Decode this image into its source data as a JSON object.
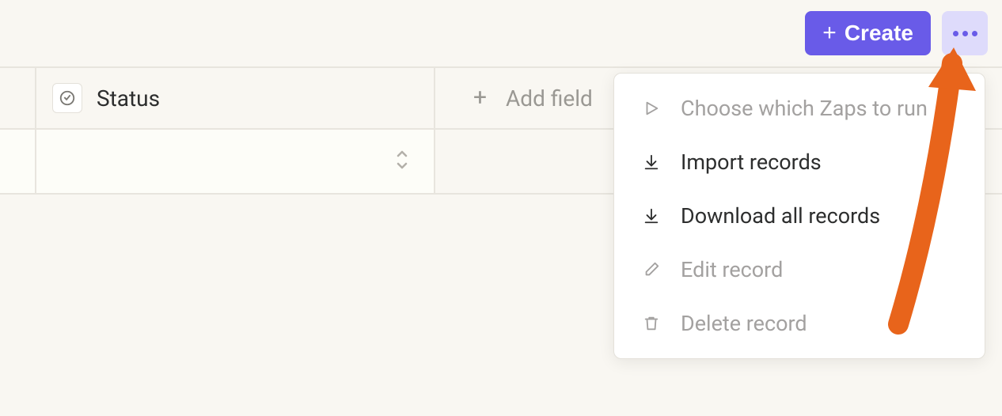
{
  "toolbar": {
    "create_label": "Create"
  },
  "columns": {
    "status_label": "Status",
    "add_field_label": "Add field"
  },
  "menu": {
    "items": [
      {
        "label": "Choose which Zaps to run",
        "icon": "play",
        "disabled": true
      },
      {
        "label": "Import records",
        "icon": "download",
        "disabled": false
      },
      {
        "label": "Download all records",
        "icon": "download",
        "disabled": false
      },
      {
        "label": "Edit record",
        "icon": "pencil",
        "disabled": true
      },
      {
        "label": "Delete record",
        "icon": "trash",
        "disabled": true
      }
    ]
  }
}
